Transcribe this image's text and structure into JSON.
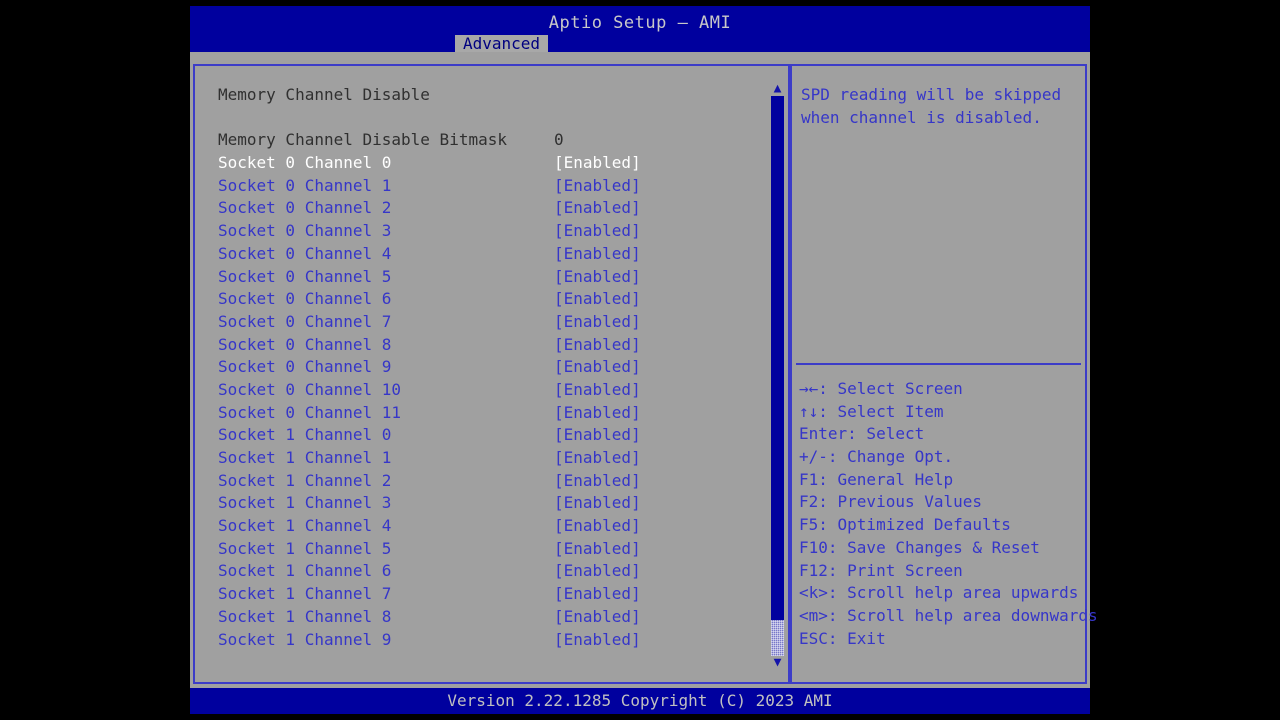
{
  "window": {
    "title": "Aptio Setup – AMI",
    "footer": "Version 2.22.1285 Copyright (C) 2023 AMI"
  },
  "tabs": [
    {
      "label": "Advanced",
      "active": true
    }
  ],
  "main": {
    "section_title": "Memory Channel Disable",
    "rows": [
      {
        "label": "Memory Channel Disable Bitmask",
        "value": "0",
        "type": "value",
        "selected": false
      },
      {
        "label": "Socket 0 Channel 0",
        "value": "[Enabled]",
        "type": "option",
        "selected": true
      },
      {
        "label": "Socket 0 Channel 1",
        "value": "[Enabled]",
        "type": "option",
        "selected": false
      },
      {
        "label": "Socket 0 Channel 2",
        "value": "[Enabled]",
        "type": "option",
        "selected": false
      },
      {
        "label": "Socket 0 Channel 3",
        "value": "[Enabled]",
        "type": "option",
        "selected": false
      },
      {
        "label": "Socket 0 Channel 4",
        "value": "[Enabled]",
        "type": "option",
        "selected": false
      },
      {
        "label": "Socket 0 Channel 5",
        "value": "[Enabled]",
        "type": "option",
        "selected": false
      },
      {
        "label": "Socket 0 Channel 6",
        "value": "[Enabled]",
        "type": "option",
        "selected": false
      },
      {
        "label": "Socket 0 Channel 7",
        "value": "[Enabled]",
        "type": "option",
        "selected": false
      },
      {
        "label": "Socket 0 Channel 8",
        "value": "[Enabled]",
        "type": "option",
        "selected": false
      },
      {
        "label": "Socket 0 Channel 9",
        "value": "[Enabled]",
        "type": "option",
        "selected": false
      },
      {
        "label": "Socket 0 Channel 10",
        "value": "[Enabled]",
        "type": "option",
        "selected": false
      },
      {
        "label": "Socket 0 Channel 11",
        "value": "[Enabled]",
        "type": "option",
        "selected": false
      },
      {
        "label": "Socket 1 Channel 0",
        "value": "[Enabled]",
        "type": "option",
        "selected": false
      },
      {
        "label": "Socket 1 Channel 1",
        "value": "[Enabled]",
        "type": "option",
        "selected": false
      },
      {
        "label": "Socket 1 Channel 2",
        "value": "[Enabled]",
        "type": "option",
        "selected": false
      },
      {
        "label": "Socket 1 Channel 3",
        "value": "[Enabled]",
        "type": "option",
        "selected": false
      },
      {
        "label": "Socket 1 Channel 4",
        "value": "[Enabled]",
        "type": "option",
        "selected": false
      },
      {
        "label": "Socket 1 Channel 5",
        "value": "[Enabled]",
        "type": "option",
        "selected": false
      },
      {
        "label": "Socket 1 Channel 6",
        "value": "[Enabled]",
        "type": "option",
        "selected": false
      },
      {
        "label": "Socket 1 Channel 7",
        "value": "[Enabled]",
        "type": "option",
        "selected": false
      },
      {
        "label": "Socket 1 Channel 8",
        "value": "[Enabled]",
        "type": "option",
        "selected": false
      },
      {
        "label": "Socket 1 Channel 9",
        "value": "[Enabled]",
        "type": "option",
        "selected": false
      }
    ]
  },
  "scrollbar": {
    "up_arrow_icon": "scroll-up-arrow-icon",
    "down_arrow_icon": "scroll-down-arrow-icon",
    "up_glyph": "▲",
    "down_glyph": "▼"
  },
  "help": {
    "description_lines": [
      "SPD reading will be skipped",
      "when channel is disabled."
    ],
    "legend": [
      "→←: Select Screen",
      "↑↓: Select Item",
      "Enter: Select",
      "+/-: Change Opt.",
      "F1: General Help",
      "F2: Previous Values",
      "F5: Optimized Defaults",
      "F10: Save Changes & Reset",
      "F12: Print Screen",
      "<k>: Scroll help area upwards",
      "<m>: Scroll help area downwards",
      "ESC: Exit"
    ]
  },
  "colors": {
    "title_bar": "#00009e",
    "panel_bg": "#a0a0a0",
    "panel_border": "#3c3cc8",
    "item_text": "#3636c8",
    "selected_text": "#ffffff",
    "heading_text": "#303030",
    "footer_bg": "#00009e",
    "footer_text": "#c0c0c0",
    "scrollbar_track": "#00009e",
    "scrollbar_thumb": "#7878c8"
  }
}
